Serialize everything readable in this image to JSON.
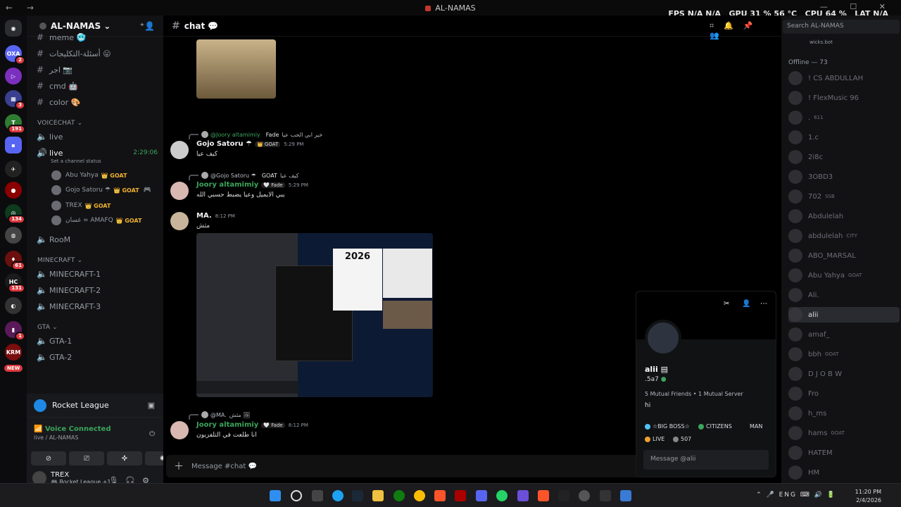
{
  "window": {
    "title": "AL-NAMAS",
    "nav": "← →",
    "controls": "— ☐ ✕"
  },
  "overlay": {
    "fps_label": "FPS",
    "fps": "N/A",
    "fps2": "N/A",
    "gpu_label": "GPU",
    "gpu": "31 %",
    "gpu_temp": "56 °C",
    "cpu_label": "CPU",
    "cpu": "64 %",
    "lat_label": "LAT",
    "lat": "N/A"
  },
  "servers": {
    "badges": [
      "2",
      "3",
      "191",
      "134",
      "61",
      "131",
      "1"
    ],
    "new_label": "NEW"
  },
  "server_name": "AL-NAMAS",
  "channels": {
    "text": [
      {
        "name": "meme 🥶"
      },
      {
        "name": "أسئلة-التكليجات 😛"
      },
      {
        "name": "اجر 📷"
      },
      {
        "name": "cmd 🤖"
      },
      {
        "name": "color 🎨"
      }
    ],
    "voicechat_cat": "VOICECHAT",
    "voice": [
      {
        "name": "live"
      },
      {
        "name": "live",
        "timer": "2:29:06",
        "status": "Set a channel status"
      }
    ],
    "voice_users": [
      {
        "name": "Abu Yahya",
        "tag": "GOAT"
      },
      {
        "name": "Gojo Satoru ☂",
        "tag": "GOAT"
      },
      {
        "name": "TREX",
        "tag": "GOAT"
      },
      {
        "name": "غسان = AMAFQ",
        "tag": "GOAT"
      }
    ],
    "room": "RooM",
    "minecraft_cat": "MINECRAFT",
    "minecraft": [
      "MINECRAFT-1",
      "MINECRAFT-2",
      "MINECRAFT-3"
    ],
    "gta_cat": "GTA",
    "gta": [
      "GTA-1",
      "GTA-2"
    ]
  },
  "activity": {
    "game": "Rocket League"
  },
  "voice": {
    "status": "Voice Connected",
    "location": "live / AL-NAMAS"
  },
  "me": {
    "name": "TREX",
    "status": "🎮 Rocket League +1"
  },
  "chat": {
    "channel": "chat 💬",
    "search_placeholder": "Search AL-NAMAS",
    "composer_placeholder": "Message #chat 💬",
    "messages": [
      {
        "reply_to": "@Joory altamimiy",
        "reply_tag": "Fade",
        "reply_text": "خير ابي الحب عيا",
        "author": "Gojo Satoru ☂",
        "tag": "GOAT",
        "time": "5:29 PM",
        "text": "كيف عيا"
      },
      {
        "reply_to": "@Gojo Satoru ☂",
        "reply_tag": "GOAT",
        "reply_text": "كيف عيا",
        "author": "Joory altamimiy",
        "tag": "Fade",
        "time": "5:29 PM",
        "text": "يبي الايميل وعيا يضبط حسبي الله"
      },
      {
        "author": "MA.",
        "time": "8:12 PM",
        "text": "مثش",
        "img_text": "2026"
      },
      {
        "reply_to": "@MA.",
        "reply_text": "مثش 🖼",
        "author": "Joory altamimiy",
        "tag": "Fade",
        "time": "8:12 PM",
        "text": "انا طلعت في التلفزيون"
      }
    ]
  },
  "profile": {
    "name": "alii",
    "handle": ".5a7",
    "mutual": "5 Mutual Friends • 1 Mutual Server",
    "bio": "hi",
    "roles": [
      "☆BIG BOSS☆",
      "CITIZENS",
      "MAN",
      "LIVE",
      "507"
    ],
    "message_placeholder": "Message @alii"
  },
  "members": {
    "top": "wicks.bot",
    "offline_header": "Offline — 73",
    "list": [
      {
        "name": "! CS ABDULLAH"
      },
      {
        "name": "! FlexMusic 96"
      },
      {
        "name": ".",
        "tag": "611"
      },
      {
        "name": "1.c"
      },
      {
        "name": "2i8c"
      },
      {
        "name": "3OBD3"
      },
      {
        "name": "702",
        "tag": "SSB"
      },
      {
        "name": "Abdulelah"
      },
      {
        "name": "abdulelah",
        "tag": "CITY"
      },
      {
        "name": "ABO_MARSAL"
      },
      {
        "name": "Abu Yahya",
        "tag": "GOAT"
      },
      {
        "name": "Ali."
      },
      {
        "name": "alii",
        "selected": true
      },
      {
        "name": "amaf_"
      },
      {
        "name": "bbh",
        "tag": "GOAT"
      },
      {
        "name": "D J O B W"
      },
      {
        "name": "Fro"
      },
      {
        "name": "h_ms"
      },
      {
        "name": "hams",
        "tag": "GOAT"
      },
      {
        "name": "HATEM"
      },
      {
        "name": "HM"
      }
    ]
  },
  "taskbar": {
    "tray": "ENG",
    "time": "11:20 PM",
    "date": "2/4/2026"
  }
}
